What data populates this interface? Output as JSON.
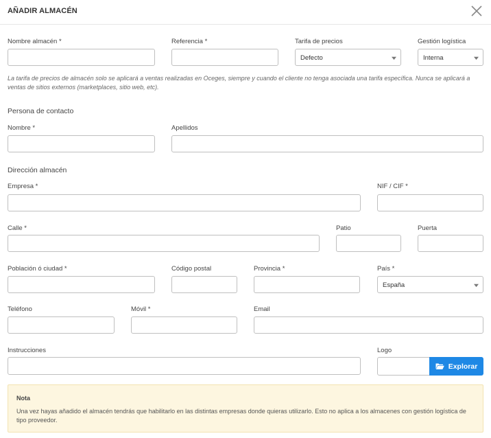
{
  "dialog": {
    "title": "AÑADIR ALMACÉN"
  },
  "fields": {
    "warehouse_name": {
      "label": "Nombre almacén *",
      "value": ""
    },
    "reference": {
      "label": "Referencia *",
      "value": ""
    },
    "price_rate": {
      "label": "Tarifa de precios",
      "selected": "Defecto"
    },
    "logistics": {
      "label": "Gestión logística",
      "selected": "Interna"
    },
    "first_name": {
      "label": "Nombre *",
      "value": ""
    },
    "last_name": {
      "label": "Apellidos",
      "value": ""
    },
    "company": {
      "label": "Empresa *",
      "value": ""
    },
    "tax_id": {
      "label": "NIF / CIF *",
      "value": ""
    },
    "street": {
      "label": "Calle *",
      "value": ""
    },
    "patio": {
      "label": "Patio",
      "value": ""
    },
    "door": {
      "label": "Puerta",
      "value": ""
    },
    "city": {
      "label": "Población ó ciudad *",
      "value": ""
    },
    "postal_code": {
      "label": "Código postal",
      "value": ""
    },
    "province": {
      "label": "Provincia *",
      "value": ""
    },
    "country": {
      "label": "País *",
      "selected": "España"
    },
    "phone": {
      "label": "Teléfono",
      "value": ""
    },
    "mobile": {
      "label": "Móvil *",
      "value": ""
    },
    "email": {
      "label": "Email",
      "value": ""
    },
    "instructions": {
      "label": "Instrucciones",
      "value": ""
    },
    "logo": {
      "label": "Logo",
      "value": "",
      "button_label": "Explorar"
    }
  },
  "help_text": "La tarifa de precios de almacén solo se aplicará a ventas realizadas en Oceges, siempre y cuando el cliente no tenga asociada una tarifa específica. Nunca se aplicará a ventas de sitios externos (marketplaces, sitio web, etc).",
  "sections": {
    "contact": "Persona de contacto",
    "address": "Dirección almacén"
  },
  "note": {
    "title": "Nota",
    "text": "Una vez hayas añadido el almacén tendrás que habilitarlo en las distintas empresas donde quieras utilizarlo. Esto no aplica a los almacenes con gestión logística de tipo proveedor."
  },
  "colors": {
    "accent": "#1e88e5",
    "note_bg": "#fdf6e0",
    "border": "#bfbfbf"
  },
  "icons": {
    "close": "close-icon",
    "caret": "caret-down-icon",
    "folder": "folder-open-icon"
  }
}
